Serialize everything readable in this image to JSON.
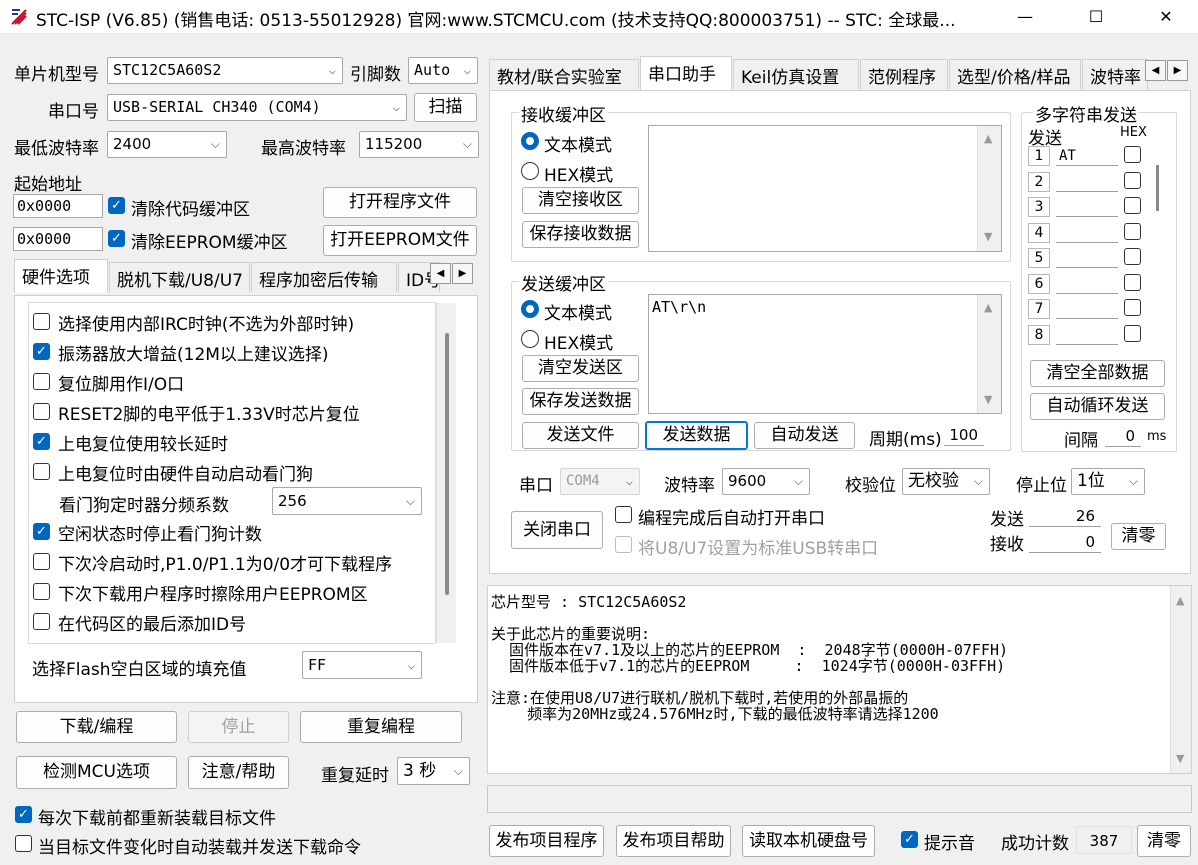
{
  "window": {
    "title": "STC-ISP (V6.85) (销售电话: 0513-55012928) 官网:www.STCMCU.com  (技术支持QQ:800003751)  -- STC: 全球最...",
    "minimize": "—",
    "maximize": "☐",
    "close": "✕"
  },
  "left": {
    "mcu_type_label": "单片机型号",
    "mcu_type": "STC12C5A60S2",
    "pins_label": "引脚数",
    "pins": "Auto",
    "port_label": "串口号",
    "port": "USB-SERIAL CH340 (COM4)",
    "scan": "扫描",
    "min_baud_label": "最低波特率",
    "min_baud": "2400",
    "max_baud_label": "最高波特率",
    "max_baud": "115200",
    "start_addr_label": "起始地址",
    "addr1": "0x0000",
    "clear_code": "清除代码缓冲区",
    "open_program": "打开程序文件",
    "addr2": "0x0000",
    "clear_eeprom": "清除EEPROM缓冲区",
    "open_eeprom": "打开EEPROM文件",
    "tabs": [
      "硬件选项",
      "脱机下载/U8/U7",
      "程序加密后传输",
      "ID号"
    ],
    "options": [
      {
        "label": "选择使用内部IRC时钟(不选为外部时钟)",
        "checked": false
      },
      {
        "label": "振荡器放大增益(12M以上建议选择)",
        "checked": true
      },
      {
        "label": "复位脚用作I/O口",
        "checked": false
      },
      {
        "label": "RESET2脚的电平低于1.33V时芯片复位",
        "checked": false
      },
      {
        "label": "上电复位使用较长延时",
        "checked": true
      },
      {
        "label": "上电复位时由硬件自动启动看门狗",
        "checked": false
      }
    ],
    "wdt_label": "看门狗定时器分频系数",
    "wdt_value": "256",
    "options2": [
      {
        "label": "空闲状态时停止看门狗计数",
        "checked": true
      },
      {
        "label": "下次冷启动时,P1.0/P1.1为0/0才可下载程序",
        "checked": false
      },
      {
        "label": "下次下载用户程序时擦除用户EEPROM区",
        "checked": false
      },
      {
        "label": "在代码区的最后添加ID号",
        "checked": false
      }
    ],
    "fill_label": "选择Flash空白区域的填充值",
    "fill_value": "FF",
    "download": "下载/编程",
    "stop": "停止",
    "reprogram": "重复编程",
    "detect": "检测MCU选项",
    "help": "注意/帮助",
    "delay_label": "重复延时",
    "delay": "3 秒",
    "reload": "每次下载前都重新装载目标文件",
    "auto_send": "当目标文件变化时自动装载并发送下载命令"
  },
  "right": {
    "tabs": [
      "教材/联合实验室",
      "串口助手",
      "Keil仿真设置",
      "范例程序",
      "选型/价格/样品",
      "波特率"
    ],
    "recv": {
      "title": "接收缓冲区",
      "text_mode": "文本模式",
      "hex_mode": "HEX模式",
      "clear": "清空接收区",
      "save": "保存接收数据",
      "content": ""
    },
    "send": {
      "title": "发送缓冲区",
      "text_mode": "文本模式",
      "hex_mode": "HEX模式",
      "clear": "清空发送区",
      "save": "保存发送数据",
      "content": "AT\\r\\n"
    },
    "send_file": "发送文件",
    "send_data": "发送数据",
    "auto_send": "自动发送",
    "period_label": "周期(ms)",
    "period": "100",
    "multi": {
      "title": "多字符串发送",
      "send_label": "发送",
      "hex_label": "HEX",
      "rows": [
        {
          "n": "1",
          "v": "AT"
        },
        {
          "n": "2",
          "v": ""
        },
        {
          "n": "3",
          "v": ""
        },
        {
          "n": "4",
          "v": ""
        },
        {
          "n": "5",
          "v": ""
        },
        {
          "n": "6",
          "v": ""
        },
        {
          "n": "7",
          "v": ""
        },
        {
          "n": "8",
          "v": ""
        }
      ],
      "clear_all": "清空全部数据",
      "auto_loop": "自动循环发送",
      "interval_label": "间隔",
      "interval": "0",
      "interval_unit": "ms"
    },
    "port_label": "串口",
    "port": "COM4",
    "baud_label": "波特率",
    "baud": "9600",
    "parity_label": "校验位",
    "parity": "无校验",
    "stop_label": "停止位",
    "stop": "1位",
    "close_port": "关闭串口",
    "auto_open": "编程完成后自动打开串口",
    "usb_setting": "将U8/U7设置为标准USB转串口",
    "sent_label": "发送",
    "sent": "26",
    "recv_label": "接收",
    "recv_count": "0",
    "clear_counts": "清零",
    "log": [
      "芯片型号 : STC12C5A60S2",
      "",
      "关于此芯片的重要说明:",
      "  固件版本在v7.1及以上的芯片的EEPROM  :  2048字节(0000H-07FFH)",
      "  固件版本低于v7.1的芯片的EEPROM     :  1024字节(0000H-03FFH)",
      "",
      "注意:在使用U8/U7进行联机/脱机下载时,若使用的外部晶振的",
      "    频率为20MHz或24.576MHz时,下载的最低波特率请选择1200"
    ],
    "publish_program": "发布项目程序",
    "publish_help": "发布项目帮助",
    "read_disk": "读取本机硬盘号",
    "sound": "提示音",
    "success_label": "成功计数",
    "success": "387",
    "clear_success": "清零"
  },
  "colors": {
    "accent": "#0067c0",
    "default_button_border": "#0078d7"
  }
}
